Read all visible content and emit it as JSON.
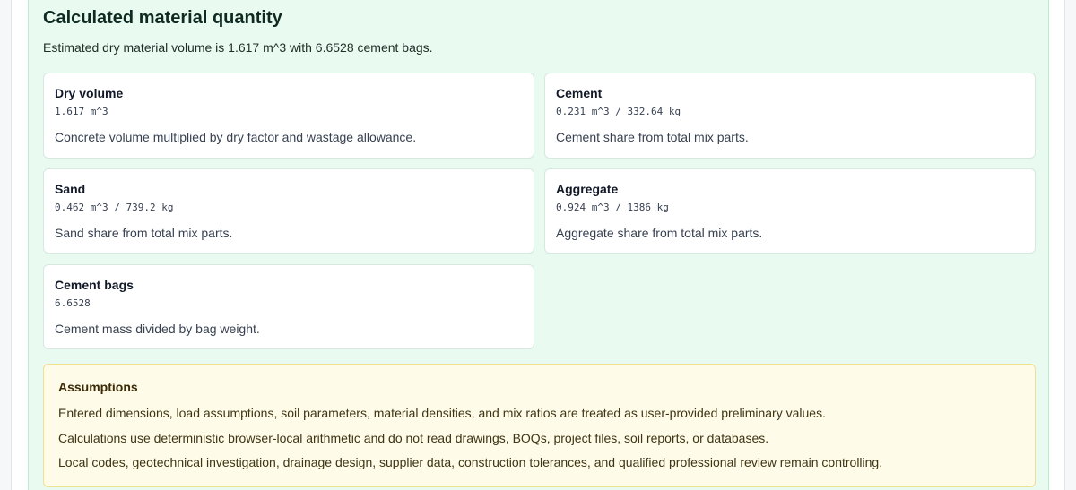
{
  "section": {
    "title": "Calculated material quantity",
    "summary": "Estimated dry material volume is 1.617 m^3 with 6.6528 cement bags."
  },
  "cards": [
    {
      "title": "Dry volume",
      "value": "1.617 m^3",
      "description": "Concrete volume multiplied by dry factor and wastage allowance."
    },
    {
      "title": "Cement",
      "value": "0.231 m^3 / 332.64 kg",
      "description": "Cement share from total mix parts."
    },
    {
      "title": "Sand",
      "value": "0.462 m^3 / 739.2 kg",
      "description": "Sand share from total mix parts."
    },
    {
      "title": "Aggregate",
      "value": "0.924 m^3 / 1386 kg",
      "description": "Aggregate share from total mix parts."
    },
    {
      "title": "Cement bags",
      "value": "6.6528",
      "description": "Cement mass divided by bag weight."
    }
  ],
  "assumptions": {
    "title": "Assumptions",
    "lines": [
      "Entered dimensions, load assumptions, soil parameters, material densities, and mix ratios are treated as user-provided preliminary values.",
      "Calculations use deterministic browser-local arithmetic and do not read drawings, BOQs, project files, soil reports, or databases.",
      "Local codes, geotechnical investigation, drainage design, supplier data, construction tolerances, and qualified professional review remain controlling."
    ]
  }
}
